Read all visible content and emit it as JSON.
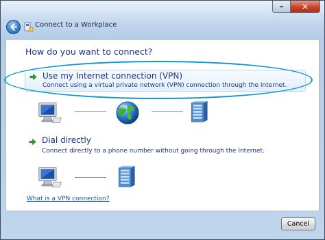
{
  "window": {
    "title": "Connect to a Workplace",
    "minimize_glyph": "–",
    "close_glyph": "✕"
  },
  "content": {
    "heading": "How do you want to connect?",
    "options": [
      {
        "title": "Use my Internet connection (VPN)",
        "description": "Connect using a virtual private network (VPN) connection through the Internet.",
        "icon": "green-arrow-icon",
        "highlighted": true
      },
      {
        "title": "Dial directly",
        "description": "Connect directly to a phone number without going through the Internet.",
        "icon": "green-arrow-icon",
        "highlighted": false
      }
    ],
    "help_link": "What is a VPN connection?"
  },
  "footer": {
    "cancel_label": "Cancel"
  },
  "colors": {
    "heading_blue": "#1e3287",
    "link_blue": "#0b57c7",
    "highlight_ring": "#0d95d6",
    "option_arrow_green": "#2e9c2e"
  },
  "diagrams": {
    "vpn": [
      "computer-icon",
      "globe-icon",
      "server-icon"
    ],
    "dial": [
      "computer-icon",
      "server-icon"
    ]
  }
}
